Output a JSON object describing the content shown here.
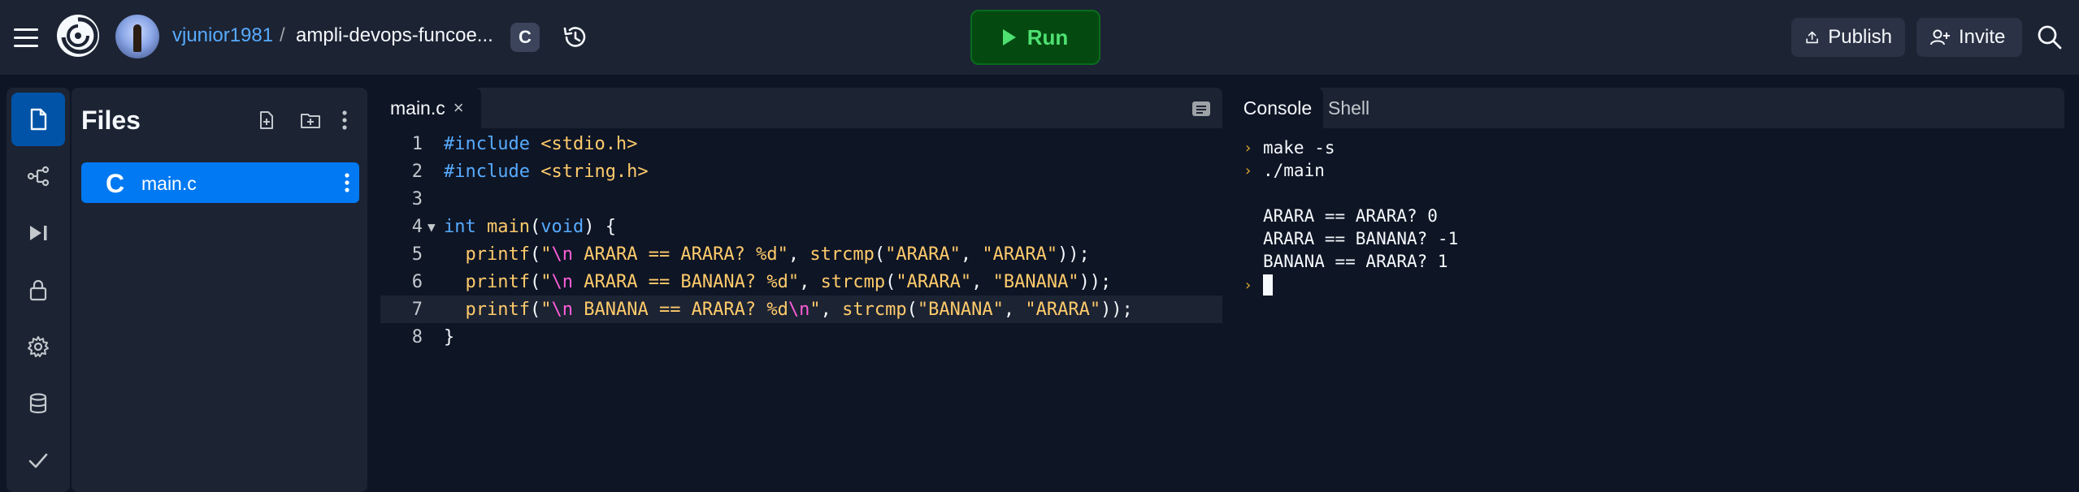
{
  "header": {
    "username": "vjunior1981",
    "separator": "/",
    "repl_name": "ampli-devops-funcoe...",
    "language_badge": "C",
    "run_label": "Run",
    "publish_label": "Publish",
    "invite_label": "Invite"
  },
  "rail": {
    "items": [
      "files-icon",
      "git-icon",
      "debugger-icon",
      "secrets-icon",
      "settings-icon",
      "database-icon",
      "checks-icon"
    ],
    "active": "files-icon"
  },
  "files": {
    "title": "Files",
    "items": [
      {
        "glyph": "C",
        "name": "main.c"
      }
    ]
  },
  "editor": {
    "tab_label": "main.c",
    "tab_close": "×",
    "lines": [
      {
        "num": "1"
      },
      {
        "num": "2"
      },
      {
        "num": "3"
      },
      {
        "num": "4"
      },
      {
        "num": "5"
      },
      {
        "num": "6"
      },
      {
        "num": "7"
      },
      {
        "num": "8"
      }
    ],
    "fold_marker": "▼"
  },
  "console": {
    "tabs": [
      "Console",
      "Shell"
    ],
    "commands": [
      "make -s",
      "./main"
    ],
    "output": [
      "ARARA == ARARA? 0",
      "ARARA == BANANA? -1",
      "BANANA == ARARA? 1"
    ]
  },
  "colors": {
    "background": "#0e1525",
    "panel": "#1c2333",
    "accent": "#0079f2",
    "run_green": "#4fe072",
    "link_blue": "#57abff"
  }
}
